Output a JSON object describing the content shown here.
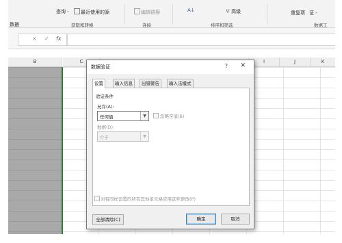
{
  "ribbon": {
    "left_group_label": "数据",
    "query_label": "查询 -",
    "recent_sources_label": "最近使用的源",
    "get_transform_label": "获取和转换",
    "edit_links_label": "编辑链接",
    "connections_label": "连接",
    "az_label": "A↓",
    "advanced_label": "高级",
    "sort_filter_label": "排序和筛选",
    "duplicates_label": "重复项",
    "validation_label": "证 -",
    "data_tools_label": "数据工"
  },
  "formula_bar": {
    "cancel_glyph": "×",
    "enter_glyph": "✓",
    "fx_glyph": "fx",
    "value": ""
  },
  "columns": [
    "B",
    "C",
    "I",
    "J",
    "K"
  ],
  "dialog": {
    "title": "数据验证",
    "help": "?",
    "close": "✕",
    "tabs": [
      "设置",
      "输入信息",
      "出错警告",
      "输入法模式"
    ],
    "section_title": "验证条件",
    "allow_label": "允许(A):",
    "allow_value": "任何值",
    "ignore_blank_label": "忽略空值(B)",
    "data_label": "数据(D):",
    "data_value": "介于",
    "apply_all_label": "对有同样设置的所有其他单元格应用这些更改(P)",
    "clear_all": "全部清除(C)",
    "ok": "确定",
    "cancel": "取消"
  }
}
